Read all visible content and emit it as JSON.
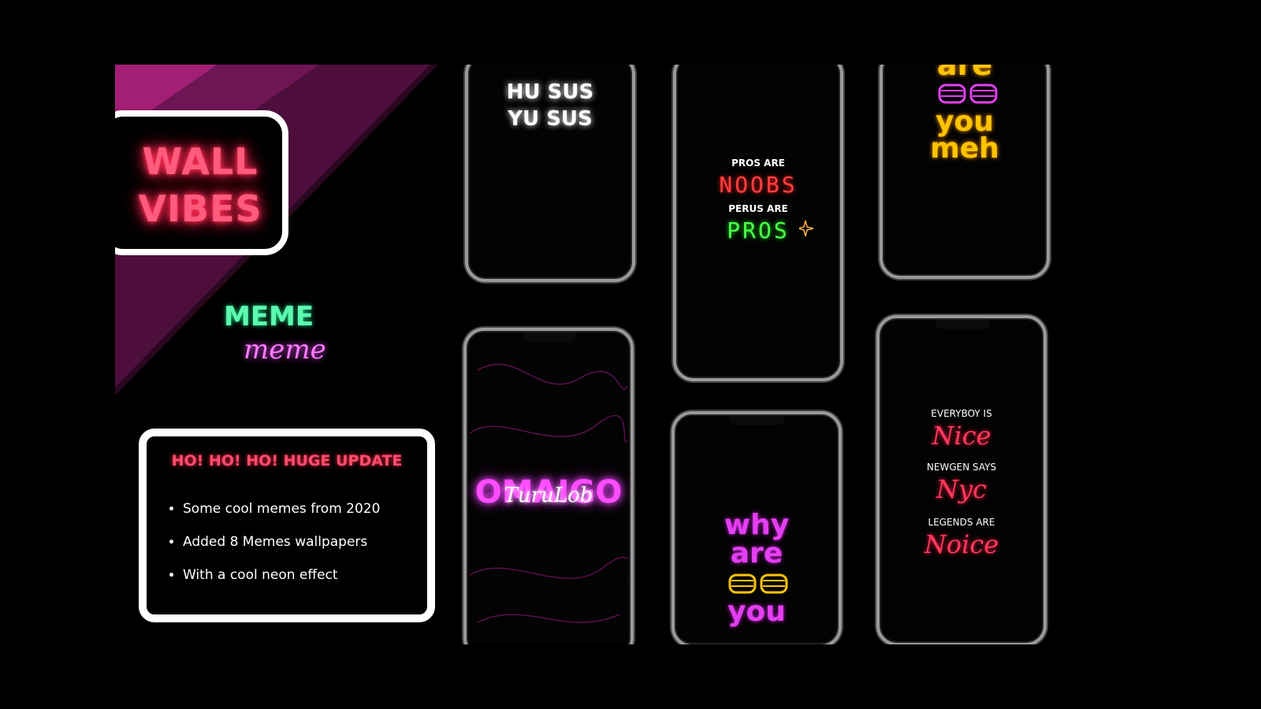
{
  "brand": {
    "line1": "WALL",
    "line2": "VIBES"
  },
  "meme": {
    "line1": "MEME",
    "line2": "meme"
  },
  "update": {
    "title": "HO! HO! HO! HUGE UPDATE",
    "items": [
      "Some cool memes from 2020",
      "Added 8 Memes wallpapers",
      "With a cool neon effect"
    ]
  },
  "phones": {
    "hu_sus": {
      "line1": "HU SUS",
      "line2": "YU SUS"
    },
    "pros": {
      "l1": "PROS ARE",
      "l2": "NOOBS",
      "l3": "PERUS ARE",
      "l4": "PROS"
    },
    "are_you": {
      "l1": "are",
      "l2": "you",
      "l3": "meh"
    },
    "omaigo": {
      "l1": "OMAIGO",
      "l2": "TuruLob"
    },
    "why": {
      "l1": "why",
      "l2": "are",
      "l3": "you"
    },
    "everyboy": {
      "l1": "EVERYBOY IS",
      "l2": "Nice",
      "l3": "NEWGEN SAYS",
      "l4": "Nyc",
      "l5": "LEGENDS ARE",
      "l6": "Noice"
    }
  },
  "colors": {
    "pink": "#ff2d55",
    "green": "#19e28a",
    "magenta": "#e33ff2",
    "yellow": "#ffc400"
  },
  "icons": [
    "sparkle-icon",
    "shutter-shades-icon"
  ]
}
